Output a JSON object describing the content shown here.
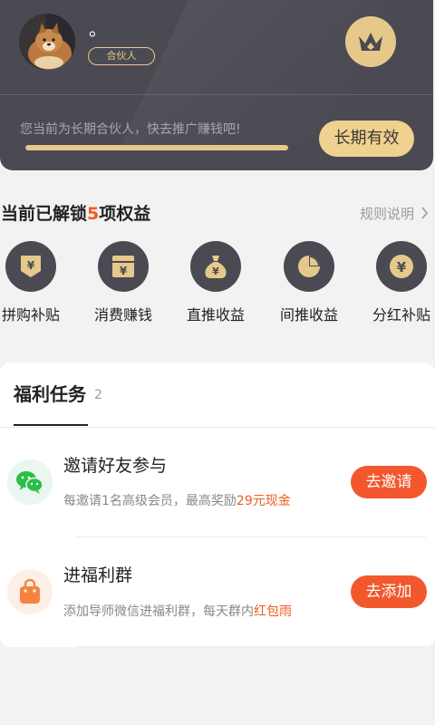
{
  "profile": {
    "nickname": "。",
    "role": "合伙人",
    "crown_icon": "crown-icon"
  },
  "card": {
    "promo_text": "您当前为长期合伙人，快去推广赚钱吧!",
    "validity_button": "长期有效",
    "progress_fraction": 1.0,
    "accent_color": "#e6c98a"
  },
  "benefits": {
    "title_prefix": "当前已解锁",
    "count": "5",
    "title_suffix": "项权益",
    "rules_link": "规则说明",
    "items": [
      {
        "label": "拼购补贴",
        "icon": "yen-shield-icon"
      },
      {
        "label": "消费赚钱",
        "icon": "yen-card-icon"
      },
      {
        "label": "直推收益",
        "icon": "money-bag-icon"
      },
      {
        "label": "间推收益",
        "icon": "pie-chart-icon"
      },
      {
        "label": "分红补贴",
        "icon": "yen-coin-icon"
      }
    ]
  },
  "tasks": {
    "title": "福利任务",
    "count": "2",
    "items": [
      {
        "title": "邀请好友参与",
        "desc_prefix": "每邀请1名高级会员，最高奖励",
        "desc_highlight": "29元现金",
        "button": "去邀请",
        "icon": "wechat-icon"
      },
      {
        "title": "进福利群",
        "desc_prefix": "添加导师微信进福利群，每天群内",
        "desc_highlight": "红包雨",
        "button": "去添加",
        "icon": "shopping-bag-icon"
      }
    ]
  }
}
